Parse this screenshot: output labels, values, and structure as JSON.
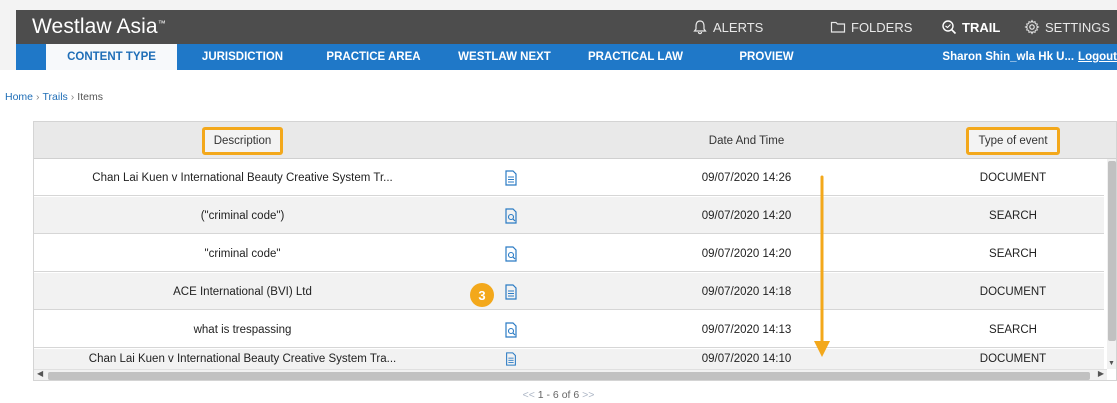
{
  "header": {
    "brand": "Westlaw Asia",
    "brand_tm": "™",
    "nav": [
      {
        "label": "ALERTS",
        "icon": "bell-icon"
      },
      {
        "label": "FOLDERS",
        "icon": "folder-icon"
      },
      {
        "label": "TRAIL",
        "icon": "trail-search-icon"
      },
      {
        "label": "SETTINGS",
        "icon": "gear-icon"
      }
    ]
  },
  "tabs": [
    {
      "label": "CONTENT TYPE"
    },
    {
      "label": "JURISDICTION"
    },
    {
      "label": "PRACTICE AREA"
    },
    {
      "label": "WESTLAW NEXT"
    },
    {
      "label": "PRACTICAL LAW"
    },
    {
      "label": "PROVIEW"
    }
  ],
  "user": {
    "name": "Sharon Shin_wla Hk U...",
    "logout": "Logout"
  },
  "breadcrumb": {
    "home": "Home",
    "trails": "Trails",
    "items": "Items",
    "separator": "›"
  },
  "table": {
    "columns": {
      "description": "Description",
      "date": "Date And Time",
      "type": "Type of event"
    },
    "rows": [
      {
        "description": "Chan Lai Kuen v International Beauty Creative System Tr...",
        "icon": "document-icon",
        "date": "09/07/2020 14:26",
        "type": "DOCUMENT"
      },
      {
        "description": "(\"criminal code\")",
        "icon": "search-document-icon",
        "date": "09/07/2020 14:20",
        "type": "SEARCH"
      },
      {
        "description": "\"criminal code\"",
        "icon": "search-document-icon",
        "date": "09/07/2020 14:20",
        "type": "SEARCH"
      },
      {
        "description": "ACE International (BVI) Ltd",
        "icon": "document-icon",
        "date": "09/07/2020 14:18",
        "type": "DOCUMENT"
      },
      {
        "description": "what is trespassing",
        "icon": "search-document-icon",
        "date": "09/07/2020 14:13",
        "type": "SEARCH"
      },
      {
        "description": "Chan Lai Kuen v International Beauty Creative System Tra...",
        "icon": "document-icon",
        "date": "09/07/2020 14:10",
        "type": "DOCUMENT"
      }
    ]
  },
  "annotation": {
    "badge": "3",
    "highlight_color": "#f3a81b"
  },
  "pager": {
    "prev": "<<",
    "text": "1 - 6 of 6",
    "next": ">>"
  },
  "colors": {
    "header_bg": "#4d4d4d",
    "nav_bg": "#1f78c8",
    "accent": "#f3a81b",
    "icon_blue": "#2b7bc4"
  }
}
